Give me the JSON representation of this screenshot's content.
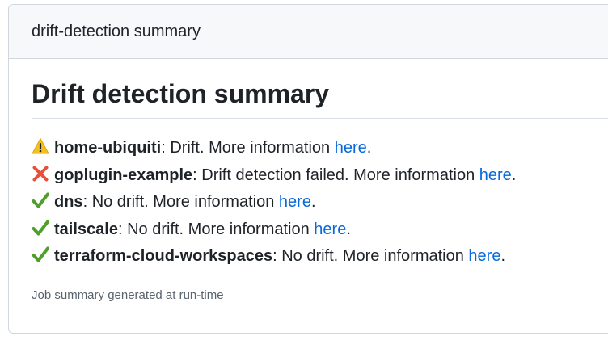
{
  "header": {
    "title": "drift-detection summary"
  },
  "summary": {
    "heading": "Drift detection summary",
    "more_info_text": "More information",
    "link_label": "here",
    "items": [
      {
        "status": "warning",
        "icon": "warning-icon",
        "name": "home-ubiquiti",
        "message": "Drift."
      },
      {
        "status": "failed",
        "icon": "cross-mark-icon",
        "name": "goplugin-example",
        "message": "Drift detection failed."
      },
      {
        "status": "ok",
        "icon": "check-mark-icon",
        "name": "dns",
        "message": "No drift."
      },
      {
        "status": "ok",
        "icon": "check-mark-icon",
        "name": "tailscale",
        "message": "No drift."
      },
      {
        "status": "ok",
        "icon": "check-mark-icon",
        "name": "terraform-cloud-workspaces",
        "message": "No drift."
      }
    ],
    "footer": "Job summary generated at run-time"
  },
  "colors": {
    "link": "#0969da",
    "warning": "#f4c01e",
    "failed": "#e8503a",
    "ok": "#4ea02a"
  }
}
